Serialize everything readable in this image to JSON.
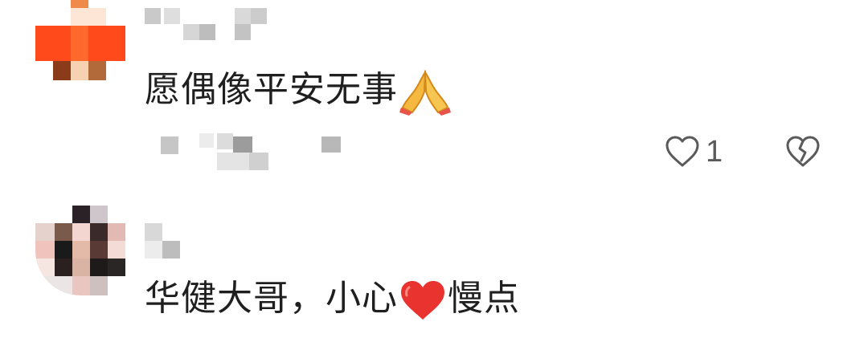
{
  "comments": [
    {
      "text_before_emoji": "愿偶像平安无事",
      "emoji": "folded-hands",
      "text_after_emoji": "",
      "like_count": "1",
      "avatar_colors": [
        "#ff4a1c",
        "#ffffff",
        "#8a3b1a",
        "#f6c8a0",
        "#b36a3a",
        "#f08a4a"
      ],
      "username_obscured": true,
      "meta_obscured": true
    },
    {
      "text_before_emoji": "华健大哥，小心",
      "emoji": "red-heart",
      "text_after_emoji": "慢点",
      "avatar_colors": [
        "#2a2226",
        "#cfc6cc",
        "#f2d6cf",
        "#7a5a4a",
        "#1a1a1a",
        "#e3b9a8"
      ],
      "username_obscured": true
    }
  ],
  "colors": {
    "text": "#1f1f1f",
    "icon": "#5a5a5a",
    "heart": "#e8332e",
    "hands": "#f5b942"
  }
}
